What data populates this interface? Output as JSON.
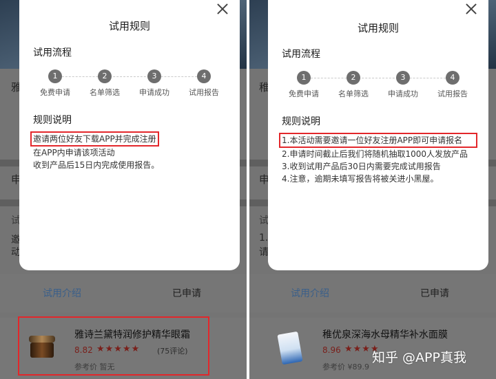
{
  "left_screen": {
    "modal": {
      "title": "试用规则",
      "process_heading": "试用流程",
      "steps": [
        {
          "num": "1",
          "label": "免费申请"
        },
        {
          "num": "2",
          "label": "名单筛选"
        },
        {
          "num": "3",
          "label": "申请成功"
        },
        {
          "num": "4",
          "label": "试用报告"
        }
      ],
      "rules_heading": "规则说明",
      "rules": [
        "邀请两位好友下载APP并完成注册",
        "在APP内申请该项活动",
        "收到产品后15日内完成使用报告。"
      ]
    },
    "background": {
      "fragments": [
        "雅",
        "申",
        "试",
        "邀",
        "动"
      ]
    },
    "tabs": [
      "试用介绍",
      "已申请"
    ],
    "product": {
      "name": "雅诗兰黛特润修护精华眼霜",
      "rating": "8.82",
      "stars": "★★★★★",
      "reviews": "(75评论)",
      "reference_price": "参考价 暂无"
    }
  },
  "right_screen": {
    "modal": {
      "title": "试用规则",
      "process_heading": "试用流程",
      "steps": [
        {
          "num": "1",
          "label": "免费申请"
        },
        {
          "num": "2",
          "label": "名单筛选"
        },
        {
          "num": "3",
          "label": "申请成功"
        },
        {
          "num": "4",
          "label": "试用报告"
        }
      ],
      "rules_heading": "规则说明",
      "rules": [
        "1.本活动需要邀请一位好友注册APP即可申请报名",
        "2.申请时间截止后我们将随机抽取1000人发放产品",
        "3.收到试用产品后30日内需要完成试用报告",
        "4.注意，逾期未填写报告将被关进小黑屋。"
      ]
    },
    "background": {
      "fragments": [
        "稚",
        "申",
        "试",
        "1.",
        "请"
      ]
    },
    "tabs": [
      "试用介绍",
      "已申请"
    ],
    "product": {
      "name": "稚优泉深海水母精华补水面膜",
      "rating": "8.96",
      "stars": "★★★★",
      "reference_price": "参考价 ¥89.9"
    }
  },
  "watermark": "知乎 @APP真我",
  "colors": {
    "highlight": "#e3262a",
    "tab_active": "#3a5f8a",
    "rating": "#7a1f1a",
    "overlay": "#6c6c6c"
  },
  "icons": {
    "close": "close-icon",
    "star": "star-icon"
  }
}
